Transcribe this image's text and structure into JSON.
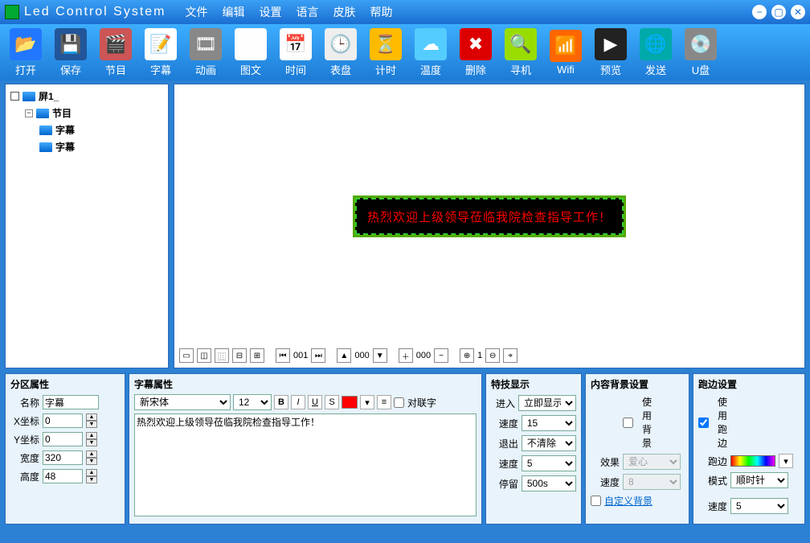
{
  "app_title": "Led Control System",
  "menu": [
    "文件",
    "编辑",
    "设置",
    "语言",
    "皮肤",
    "帮助"
  ],
  "toolbar": [
    {
      "label": "打开",
      "icon": "📂",
      "bg": "#27f"
    },
    {
      "label": "保存",
      "icon": "💾",
      "bg": "#259"
    },
    {
      "label": "节目",
      "icon": "🎬",
      "bg": "#c55"
    },
    {
      "label": "字幕",
      "icon": "📝",
      "bg": "#fff"
    },
    {
      "label": "动画",
      "icon": "🎞",
      "bg": "#888"
    },
    {
      "label": "图文",
      "icon": "🖼",
      "bg": "#fefefe"
    },
    {
      "label": "时间",
      "icon": "📅",
      "bg": "#fefefe"
    },
    {
      "label": "表盘",
      "icon": "🕒",
      "bg": "#eee"
    },
    {
      "label": "计时",
      "icon": "⏳",
      "bg": "#fb0"
    },
    {
      "label": "温度",
      "icon": "☁",
      "bg": "#5cf"
    },
    {
      "label": "删除",
      "icon": "✖",
      "bg": "#d00"
    },
    {
      "label": "寻机",
      "icon": "🔍",
      "bg": "#9d0"
    },
    {
      "label": "Wifi",
      "icon": "📶",
      "bg": "#f60"
    },
    {
      "label": "预览",
      "icon": "▶",
      "bg": "#222"
    },
    {
      "label": "发送",
      "icon": "🌐",
      "bg": "#0aa"
    },
    {
      "label": "U盘",
      "icon": "💿",
      "bg": "#888"
    }
  ],
  "tree": {
    "root": "屏1_",
    "program": "节目",
    "items": [
      "字幕",
      "字幕"
    ]
  },
  "led_text": "热烈欢迎上级领导莅临我院检查指导工作！",
  "preview_nums": {
    "a": "001",
    "b": "000",
    "c": "000",
    "d": "1"
  },
  "panels": {
    "zone": {
      "title": "分区属性",
      "name_label": "名称",
      "name_value": "字幕",
      "x_label": "X坐标",
      "x_value": "0",
      "y_label": "Y坐标",
      "y_value": "0",
      "w_label": "宽度",
      "w_value": "320",
      "h_label": "高度",
      "h_value": "48"
    },
    "subtitle": {
      "title": "字幕属性",
      "font": "新宋体",
      "size": "12",
      "align_label": "对联字",
      "text": "热烈欢迎上级领导莅临我院检查指导工作！"
    },
    "effect": {
      "title": "特技显示",
      "enter_label": "进入",
      "enter_value": "立即显示",
      "speed1_label": "速度",
      "speed1_value": "15",
      "exit_label": "退出",
      "exit_value": "不清除",
      "speed2_label": "速度",
      "speed2_value": "5",
      "stay_label": "停留",
      "stay_value": "500s"
    },
    "bg": {
      "title": "内容背景设置",
      "use_label": "使用背景",
      "effect_label": "效果",
      "effect_value": "爱心",
      "speed_label": "速度",
      "speed_value": "8",
      "custom_label": "自定义背景"
    },
    "border": {
      "title": "跑边设置",
      "use_label": "使用跑边",
      "border_label": "跑边",
      "mode_label": "模式",
      "mode_value": "顺时针",
      "speed_label": "速度",
      "speed_value": "5"
    }
  }
}
